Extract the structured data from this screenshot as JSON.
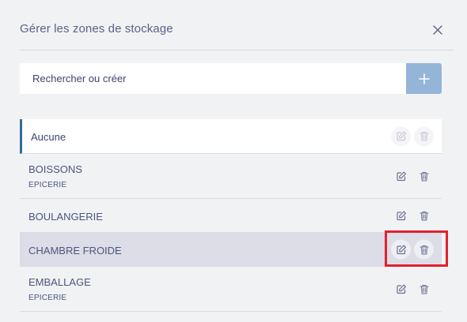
{
  "dialog": {
    "title": "Gérer les zones de stockage",
    "close_icon": "close-icon"
  },
  "search": {
    "placeholder": "Rechercher ou créer",
    "value": "",
    "add_icon": "plus-icon"
  },
  "colors": {
    "accent_border": "#2f6e9e",
    "add_button": "#94b5d8",
    "selected_row": "#dcdde7",
    "highlight_box": "#e3202e"
  },
  "zones": [
    {
      "name": "Aucune",
      "subtitle": "",
      "actions_disabled": true,
      "selected": false
    },
    {
      "name": "BOISSONS",
      "subtitle": "EPICERIE",
      "actions_disabled": false,
      "selected": false
    },
    {
      "name": "BOULANGERIE",
      "subtitle": "",
      "actions_disabled": false,
      "selected": false
    },
    {
      "name": "CHAMBRE FROIDE",
      "subtitle": "",
      "actions_disabled": false,
      "selected": true
    },
    {
      "name": "EMBALLAGE",
      "subtitle": "EPICERIE",
      "actions_disabled": false,
      "selected": false
    }
  ],
  "row_action_icons": [
    "edit-icon",
    "trash-icon"
  ]
}
